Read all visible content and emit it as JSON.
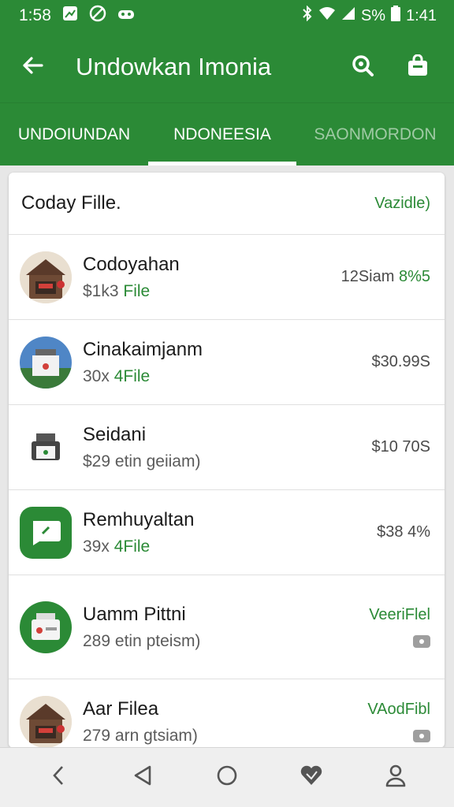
{
  "status_bar": {
    "time": "1:58",
    "battery_text": "S%",
    "clock_right": "1:41"
  },
  "app_bar": {
    "title": "Undowkan Imonia",
    "back_icon": "arrow-left-icon",
    "actions": [
      "search-icon",
      "bag-icon"
    ]
  },
  "tabs": [
    {
      "label": "UNDOIUNDAN",
      "active": false
    },
    {
      "label": "NDONEESIA",
      "active": true
    },
    {
      "label": "SAONMORDON",
      "active": false
    }
  ],
  "card": {
    "title": "Coday Fille.",
    "action": "Vazidle)",
    "rows": [
      {
        "title": "Codoyahan",
        "sub_a": "$1k3",
        "sub_b": "File",
        "value_a": "12Siam",
        "value_b": "8%5"
      },
      {
        "title": "Cinakaimjanm",
        "sub_a": "30x",
        "sub_b": "4File",
        "value_a": "$30.99S",
        "value_b": ""
      },
      {
        "title": "Seidani",
        "sub_a": "$29",
        "sub_b": "etin geiiam)",
        "value_a": "$10 70S",
        "value_b": ""
      },
      {
        "title": "Remhuyaltan",
        "sub_a": "39x",
        "sub_b": "4File",
        "value_a": "$38 4%",
        "value_b": ""
      },
      {
        "title": "Uamm Pittni",
        "sub_a": "289",
        "sub_b": "etin pteism)",
        "value_a": "VeeriFlel",
        "value_b": ""
      },
      {
        "title": "Aar Filea",
        "sub_a": "279",
        "sub_b": "arn gtsiam)",
        "value_a": "VAodFibl",
        "value_b": ""
      }
    ]
  },
  "colors": {
    "primary": "#2b8a36",
    "background": "#e7e7e7",
    "card": "#ffffff"
  },
  "nav_bar": [
    "chevron-left-icon",
    "triangle-back-icon",
    "home-circle-icon",
    "heart-icon",
    "person-icon"
  ]
}
